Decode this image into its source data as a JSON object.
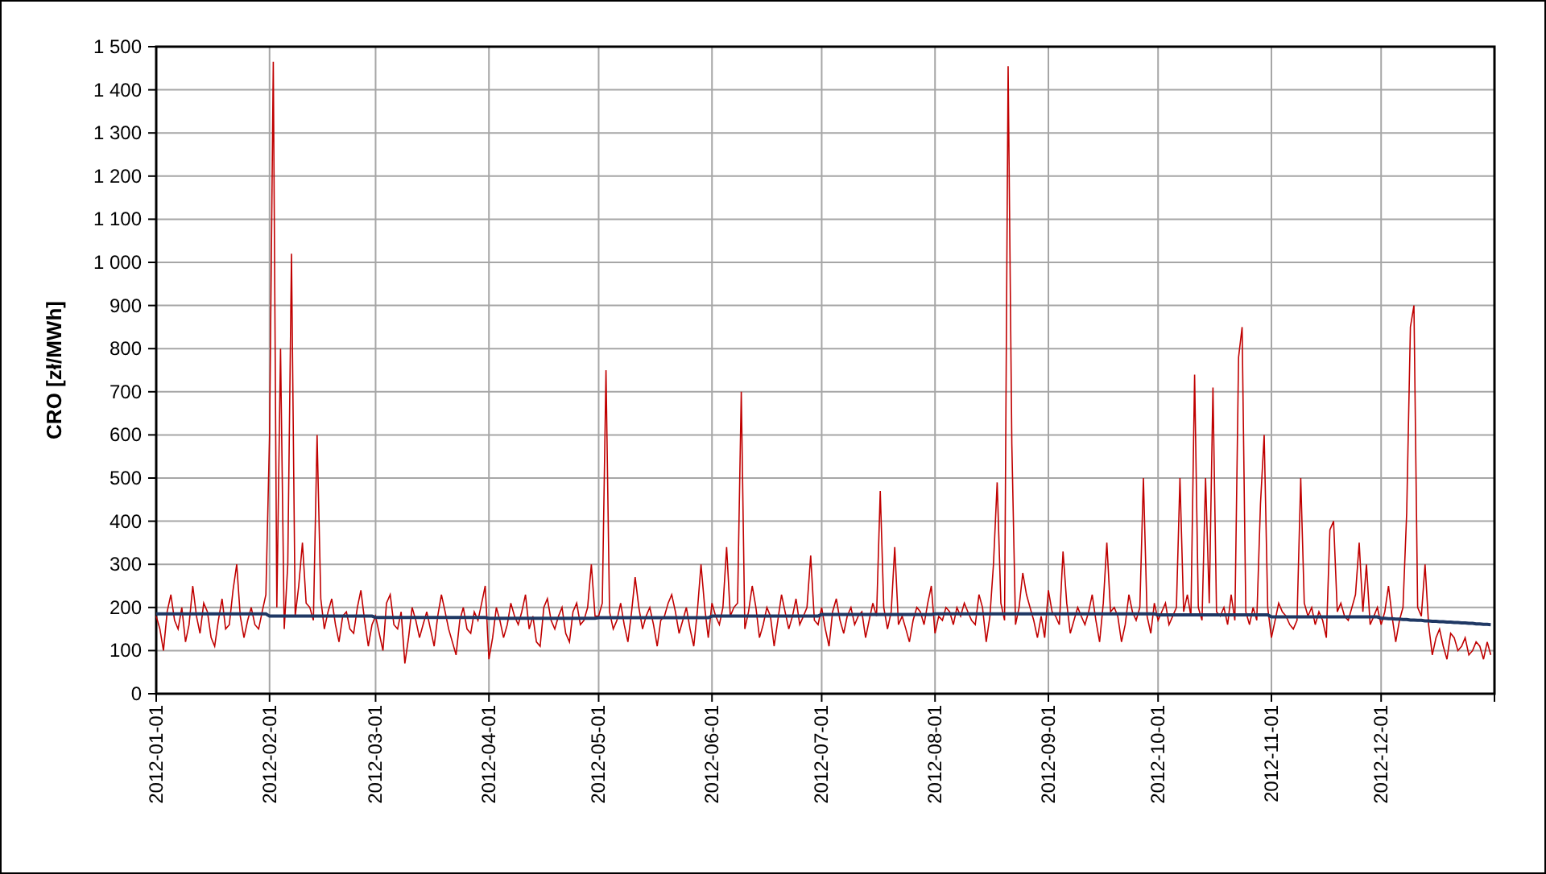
{
  "chart": {
    "chart_data": {
      "type": "line",
      "grid": true,
      "ylabel": "CRO [zł/MWh]",
      "ylim": [
        0,
        1500
      ],
      "yticks": [
        {
          "value": 0,
          "label": "0"
        },
        {
          "value": 100,
          "label": "100"
        },
        {
          "value": 200,
          "label": "200"
        },
        {
          "value": 300,
          "label": "300"
        },
        {
          "value": 400,
          "label": "400"
        },
        {
          "value": 500,
          "label": "500"
        },
        {
          "value": 600,
          "label": "600"
        },
        {
          "value": 700,
          "label": "700"
        },
        {
          "value": 800,
          "label": "800"
        },
        {
          "value": 900,
          "label": "900"
        },
        {
          "value": 1000,
          "label": "1 000"
        },
        {
          "value": 1100,
          "label": "1 100"
        },
        {
          "value": 1200,
          "label": "1 200"
        },
        {
          "value": 1300,
          "label": "1 300"
        },
        {
          "value": 1400,
          "label": "1 400"
        },
        {
          "value": 1500,
          "label": "1 500"
        }
      ],
      "categories": [
        "2012-01-01",
        null,
        null,
        null,
        null,
        null,
        null,
        null,
        null,
        null,
        null,
        null,
        null,
        null,
        null,
        null,
        null,
        null,
        null,
        null,
        null,
        null,
        null,
        null,
        null,
        null,
        null,
        null,
        null,
        null,
        null,
        "2012-02-01",
        null,
        null,
        null,
        null,
        null,
        null,
        null,
        null,
        null,
        null,
        null,
        null,
        null,
        null,
        null,
        null,
        null,
        null,
        null,
        null,
        null,
        null,
        null,
        null,
        null,
        null,
        null,
        null,
        "2012-03-01",
        null,
        null,
        null,
        null,
        null,
        null,
        null,
        null,
        null,
        null,
        null,
        null,
        null,
        null,
        null,
        null,
        null,
        null,
        null,
        null,
        null,
        null,
        null,
        null,
        null,
        null,
        null,
        null,
        null,
        null,
        "2012-04-01",
        null,
        null,
        null,
        null,
        null,
        null,
        null,
        null,
        null,
        null,
        null,
        null,
        null,
        null,
        null,
        null,
        null,
        null,
        null,
        null,
        null,
        null,
        null,
        null,
        null,
        null,
        null,
        null,
        null,
        "2012-05-01",
        null,
        null,
        null,
        null,
        null,
        null,
        null,
        null,
        null,
        null,
        null,
        null,
        null,
        null,
        null,
        null,
        null,
        null,
        null,
        null,
        null,
        null,
        null,
        null,
        null,
        null,
        null,
        null,
        null,
        null,
        "2012-06-01",
        null,
        null,
        null,
        null,
        null,
        null,
        null,
        null,
        null,
        null,
        null,
        null,
        null,
        null,
        null,
        null,
        null,
        null,
        null,
        null,
        null,
        null,
        null,
        null,
        null,
        null,
        null,
        null,
        null,
        "2012-07-01",
        null,
        null,
        null,
        null,
        null,
        null,
        null,
        null,
        null,
        null,
        null,
        null,
        null,
        null,
        null,
        null,
        null,
        null,
        null,
        null,
        null,
        null,
        null,
        null,
        null,
        null,
        null,
        null,
        null,
        null,
        "2012-08-01",
        null,
        null,
        null,
        null,
        null,
        null,
        null,
        null,
        null,
        null,
        null,
        null,
        null,
        null,
        null,
        null,
        null,
        null,
        null,
        null,
        null,
        null,
        null,
        null,
        null,
        null,
        null,
        null,
        null,
        null,
        "2012-09-01",
        null,
        null,
        null,
        null,
        null,
        null,
        null,
        null,
        null,
        null,
        null,
        null,
        null,
        null,
        null,
        null,
        null,
        null,
        null,
        null,
        null,
        null,
        null,
        null,
        null,
        null,
        null,
        null,
        null,
        "2012-10-01",
        null,
        null,
        null,
        null,
        null,
        null,
        null,
        null,
        null,
        null,
        null,
        null,
        null,
        null,
        null,
        null,
        null,
        null,
        null,
        null,
        null,
        null,
        null,
        null,
        null,
        null,
        null,
        null,
        null,
        null,
        "2012-11-01",
        null,
        null,
        null,
        null,
        null,
        null,
        null,
        null,
        null,
        null,
        null,
        null,
        null,
        null,
        null,
        null,
        null,
        null,
        null,
        null,
        null,
        null,
        null,
        null,
        null,
        null,
        null,
        null,
        null,
        "2012-12-01",
        null,
        null,
        null,
        null,
        null,
        null,
        null,
        null,
        null,
        null,
        null,
        null,
        null,
        null,
        null,
        null,
        null,
        null,
        null,
        null,
        null,
        null,
        null,
        null,
        null,
        null,
        null,
        null,
        null,
        null
      ],
      "series": [
        {
          "color": "#c00000",
          "values": [
            180,
            150,
            100,
            190,
            230,
            170,
            150,
            200,
            120,
            160,
            250,
            180,
            140,
            210,
            190,
            130,
            110,
            170,
            220,
            150,
            160,
            240,
            300,
            180,
            130,
            170,
            200,
            160,
            150,
            190,
            230,
            600,
            1465,
            200,
            800,
            150,
            300,
            1020,
            180,
            250,
            350,
            210,
            200,
            170,
            600,
            220,
            150,
            190,
            220,
            160,
            120,
            180,
            190,
            150,
            140,
            200,
            240,
            170,
            110,
            160,
            180,
            140,
            100,
            210,
            230,
            160,
            150,
            190,
            70,
            130,
            200,
            170,
            130,
            160,
            190,
            150,
            110,
            180,
            230,
            190,
            150,
            120,
            90,
            170,
            200,
            150,
            140,
            190,
            170,
            210,
            250,
            80,
            130,
            200,
            170,
            130,
            160,
            210,
            180,
            160,
            190,
            230,
            150,
            180,
            120,
            110,
            200,
            220,
            170,
            150,
            180,
            200,
            140,
            120,
            190,
            210,
            160,
            170,
            200,
            300,
            180,
            180,
            210,
            750,
            190,
            150,
            170,
            210,
            160,
            120,
            190,
            270,
            200,
            150,
            180,
            200,
            160,
            110,
            170,
            180,
            210,
            230,
            190,
            140,
            170,
            200,
            150,
            110,
            190,
            300,
            200,
            130,
            210,
            180,
            160,
            200,
            340,
            180,
            200,
            210,
            700,
            150,
            190,
            250,
            200,
            130,
            160,
            200,
            180,
            110,
            170,
            230,
            190,
            150,
            180,
            220,
            160,
            180,
            200,
            320,
            170,
            160,
            200,
            150,
            110,
            190,
            220,
            170,
            140,
            180,
            200,
            160,
            180,
            190,
            130,
            170,
            210,
            180,
            470,
            200,
            150,
            190,
            340,
            160,
            180,
            150,
            120,
            170,
            200,
            190,
            160,
            210,
            250,
            140,
            180,
            170,
            200,
            190,
            160,
            200,
            180,
            210,
            190,
            170,
            160,
            230,
            200,
            120,
            180,
            300,
            490,
            210,
            170,
            1455,
            580,
            160,
            200,
            280,
            230,
            200,
            170,
            130,
            180,
            130,
            240,
            190,
            180,
            160,
            330,
            210,
            140,
            170,
            200,
            180,
            160,
            190,
            230,
            170,
            120,
            210,
            350,
            190,
            200,
            180,
            120,
            160,
            230,
            190,
            170,
            200,
            500,
            180,
            140,
            210,
            170,
            190,
            210,
            160,
            180,
            200,
            500,
            190,
            230,
            180,
            740,
            200,
            170,
            500,
            210,
            710,
            190,
            180,
            200,
            160,
            230,
            170,
            780,
            850,
            190,
            160,
            200,
            170,
            440,
            600,
            200,
            130,
            170,
            210,
            190,
            180,
            160,
            150,
            170,
            500,
            210,
            180,
            200,
            160,
            190,
            170,
            130,
            380,
            400,
            190,
            210,
            180,
            170,
            200,
            230,
            350,
            190,
            300,
            160,
            180,
            200,
            160,
            190,
            250,
            180,
            120,
            170,
            200,
            420,
            850,
            900,
            200,
            180,
            300,
            160,
            90,
            130,
            150,
            110,
            80,
            140,
            130,
            100,
            110,
            130,
            90,
            100,
            120,
            110,
            80,
            120,
            90
          ]
        },
        {
          "color": "#1f3864",
          "values": [
            185,
            185,
            185,
            185,
            185,
            185,
            185,
            185,
            185,
            185,
            185,
            185,
            185,
            185,
            185,
            185,
            185,
            185,
            185,
            185,
            185,
            185,
            185,
            185,
            185,
            185,
            185,
            185,
            185,
            185,
            185,
            180,
            180,
            180,
            180,
            180,
            180,
            180,
            180,
            180,
            180,
            180,
            180,
            180,
            180,
            180,
            180,
            180,
            180,
            180,
            180,
            180,
            180,
            180,
            180,
            180,
            180,
            180,
            180,
            180,
            177,
            177,
            177,
            177,
            177,
            177,
            177,
            177,
            177,
            177,
            177,
            177,
            177,
            177,
            177,
            177,
            177,
            177,
            177,
            177,
            177,
            177,
            177,
            177,
            177,
            177,
            177,
            177,
            177,
            177,
            177,
            175,
            175,
            175,
            175,
            175,
            175,
            175,
            175,
            175,
            175,
            175,
            175,
            175,
            175,
            175,
            175,
            175,
            175,
            175,
            175,
            175,
            175,
            175,
            175,
            175,
            175,
            175,
            175,
            175,
            175,
            176,
            176,
            176,
            176,
            176,
            176,
            176,
            176,
            176,
            176,
            176,
            176,
            176,
            176,
            176,
            176,
            176,
            176,
            176,
            176,
            176,
            176,
            176,
            176,
            176,
            176,
            176,
            176,
            176,
            176,
            176,
            180,
            180,
            180,
            180,
            180,
            180,
            180,
            180,
            180,
            180,
            180,
            180,
            180,
            180,
            180,
            180,
            180,
            180,
            180,
            180,
            180,
            180,
            180,
            180,
            180,
            180,
            180,
            180,
            180,
            180,
            184,
            184,
            184,
            184,
            184,
            184,
            184,
            184,
            184,
            184,
            184,
            184,
            184,
            184,
            184,
            184,
            184,
            184,
            184,
            184,
            184,
            184,
            184,
            184,
            184,
            184,
            184,
            184,
            184,
            184,
            184,
            185,
            185,
            185,
            185,
            185,
            185,
            185,
            185,
            185,
            185,
            185,
            185,
            185,
            185,
            185,
            185,
            185,
            185,
            185,
            185,
            185,
            185,
            185,
            185,
            185,
            185,
            185,
            185,
            185,
            185,
            185,
            185,
            185,
            185,
            185,
            185,
            185,
            185,
            185,
            185,
            185,
            185,
            185,
            185,
            185,
            185,
            185,
            185,
            185,
            185,
            185,
            185,
            185,
            185,
            185,
            185,
            185,
            185,
            185,
            185,
            185,
            183,
            183,
            183,
            183,
            183,
            183,
            183,
            183,
            183,
            183,
            183,
            183,
            183,
            183,
            183,
            183,
            183,
            183,
            183,
            183,
            183,
            183,
            183,
            183,
            183,
            183,
            183,
            183,
            183,
            183,
            183,
            178,
            178,
            178,
            178,
            178,
            178,
            178,
            178,
            178,
            178,
            178,
            178,
            178,
            178,
            178,
            178,
            178,
            178,
            178,
            178,
            178,
            178,
            178,
            178,
            178,
            178,
            178,
            178,
            178,
            178,
            175,
            175,
            174,
            174,
            173,
            173,
            172,
            172,
            171,
            171,
            170,
            170,
            169,
            169,
            168,
            168,
            167,
            167,
            166,
            166,
            165,
            165,
            164,
            164,
            163,
            163,
            162,
            162,
            161,
            161,
            160
          ]
        }
      ]
    }
  }
}
